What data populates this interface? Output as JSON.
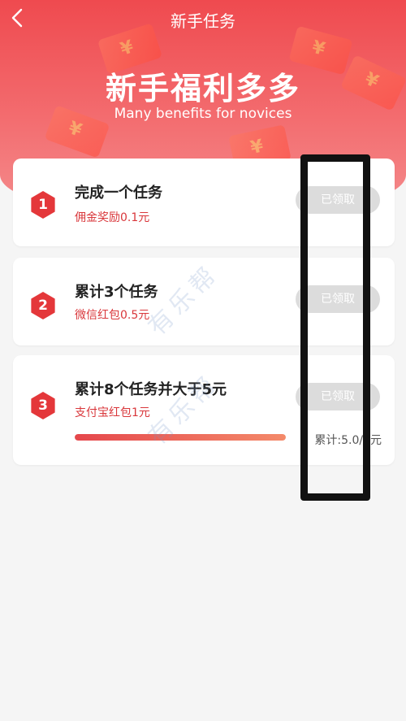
{
  "header": {
    "back_icon": "chevron-left-icon",
    "title": "新手任务"
  },
  "banner": {
    "title": "新手福利多多",
    "subtitle": "Many benefits for novices"
  },
  "tasks": [
    {
      "index": "1",
      "title": "完成一个任务",
      "reward": "佣金奖励0.1元",
      "button": "已领取"
    },
    {
      "index": "2",
      "title": "累计3个任务",
      "reward": "微信红包0.5元",
      "button": "已领取"
    },
    {
      "index": "3",
      "title": "累计8个任务并大于5元",
      "reward": "支付宝红包1元",
      "button": "已领取",
      "progress": 1.0,
      "cumulative": "累计:5.0/5元"
    }
  ],
  "watermark": "有乐帮",
  "colors": {
    "brand": "#e4373a",
    "button_disabled": "#dcdcdc"
  }
}
